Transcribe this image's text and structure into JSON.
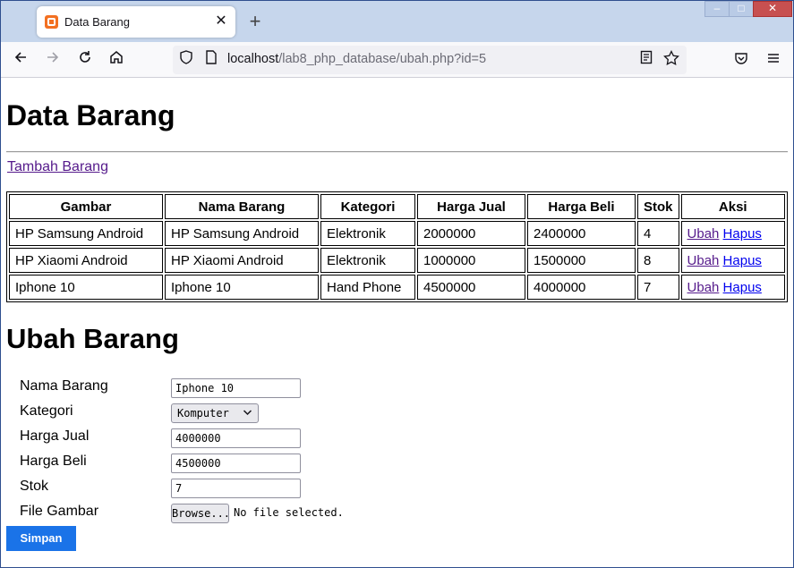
{
  "browser": {
    "tab_title": "Data Barang",
    "close_glyph": "✕",
    "newtab_glyph": "+",
    "url_host": "localhost",
    "url_path": "/lab8_php_database/ubah.php?id=5",
    "icons": [
      "back-icon",
      "forward-icon",
      "reload-icon",
      "home-icon",
      "shield-icon",
      "page-icon",
      "reader-icon",
      "bookmark-star-icon",
      "pocket-icon",
      "menu-icon"
    ]
  },
  "page": {
    "title": "Data Barang",
    "add_link": "Tambah Barang"
  },
  "table": {
    "headers": [
      "Gambar",
      "Nama Barang",
      "Kategori",
      "Harga Jual",
      "Harga Beli",
      "Stok",
      "Aksi"
    ],
    "rows": [
      {
        "gambar": "HP Samsung Android",
        "nama": "HP Samsung Android",
        "kategori": "Elektronik",
        "harga_jual": "2000000",
        "harga_beli": "2400000",
        "stok": "4",
        "edit": "Ubah",
        "delete": "Hapus"
      },
      {
        "gambar": "HP Xiaomi Android",
        "nama": "HP Xiaomi Android",
        "kategori": "Elektronik",
        "harga_jual": "1000000",
        "harga_beli": "1500000",
        "stok": "8",
        "edit": "Ubah",
        "delete": "Hapus"
      },
      {
        "gambar": "Iphone 10",
        "nama": "Iphone 10",
        "kategori": "Hand Phone",
        "harga_jual": "4500000",
        "harga_beli": "4000000",
        "stok": "7",
        "edit": "Ubah",
        "delete": "Hapus"
      }
    ]
  },
  "form": {
    "title": "Ubah Barang",
    "nama_label": "Nama Barang",
    "nama_value": "Iphone 10",
    "kategori_label": "Kategori",
    "kategori_value": "Komputer",
    "harga_jual_label": "Harga Jual",
    "harga_jual_value": "4000000",
    "harga_beli_label": "Harga Beli",
    "harga_beli_value": "4500000",
    "stok_label": "Stok",
    "stok_value": "7",
    "file_label": "File Gambar",
    "browse_label": "Browse...",
    "file_status": "No file selected.",
    "submit_label": "Simpan"
  },
  "colors": {
    "link": "#0000ee",
    "visited_link": "#551a8b",
    "submit_bg": "#1a73e8",
    "tabstrip_bg": "#c6d6ec"
  }
}
